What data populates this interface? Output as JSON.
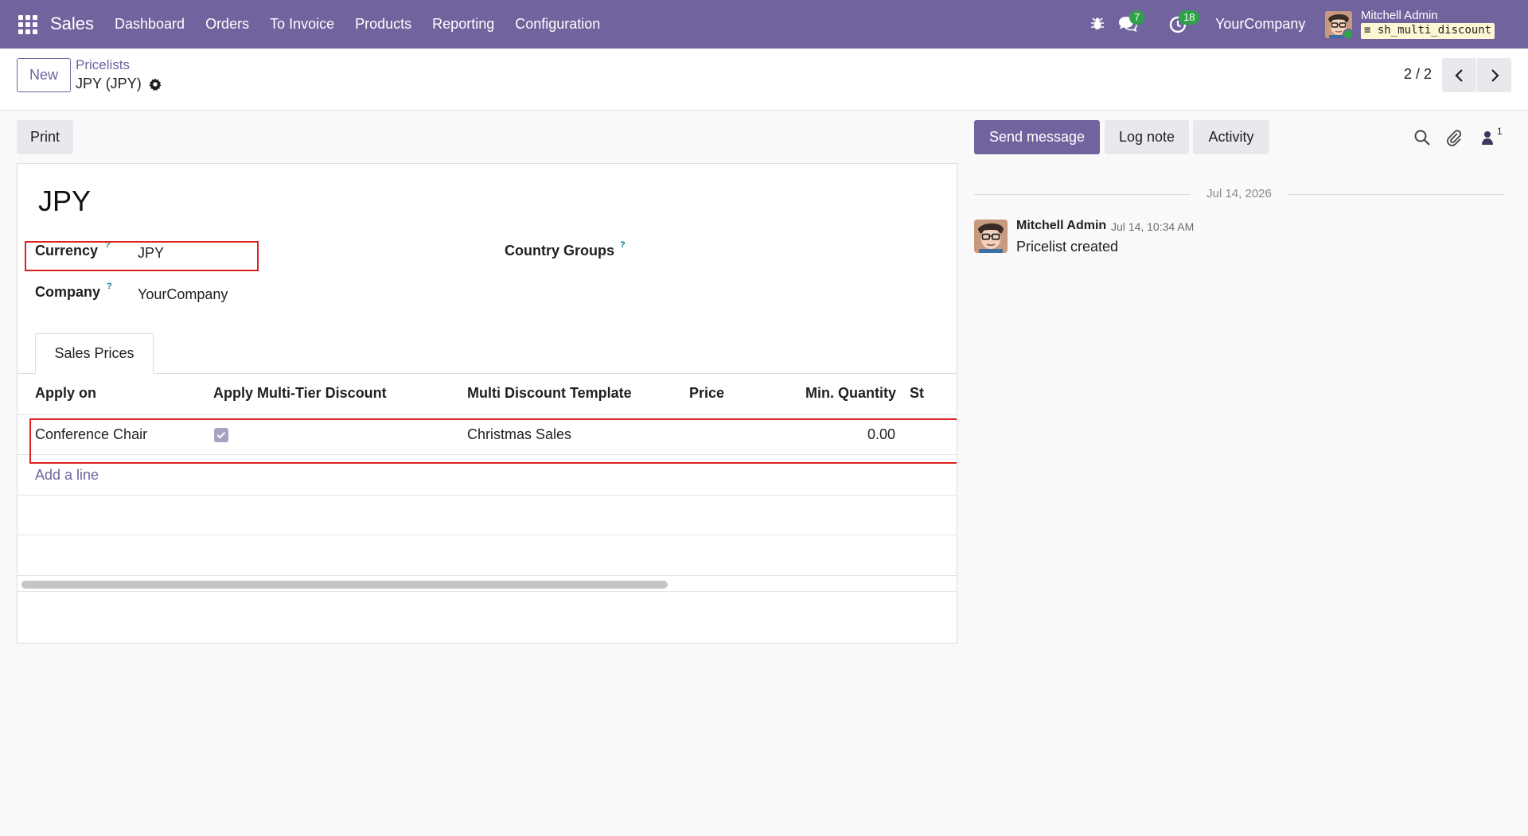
{
  "navbar": {
    "app_name": "Sales",
    "menu": [
      "Dashboard",
      "Orders",
      "To Invoice",
      "Products",
      "Reporting",
      "Configuration"
    ],
    "messages_count": "7",
    "activities_count": "18",
    "company": "YourCompany",
    "user_name": "Mitchell Admin",
    "database": "sh_multi_discount",
    "icons": [
      "apps-grid-icon",
      "bug-icon",
      "chat-icon",
      "clock-icon"
    ]
  },
  "control_panel": {
    "new_label": "New",
    "breadcrumb_parent": "Pricelists",
    "breadcrumb_current": "JPY (JPY)",
    "pager": "2 / 2"
  },
  "form": {
    "print_label": "Print",
    "title": "JPY",
    "currency_label": "Currency",
    "currency_value": "JPY",
    "company_label": "Company",
    "company_value": "YourCompany",
    "country_groups_label": "Country Groups",
    "help_mark": "?",
    "tab_label": "Sales Prices",
    "columns": [
      "Apply on",
      "Apply Multi-Tier Discount",
      "Multi Discount Template",
      "Price",
      "Min. Quantity",
      "St"
    ],
    "rows": [
      {
        "apply_on": "Conference Chair",
        "multi_tier": true,
        "template": "Christmas Sales",
        "price": "",
        "min_quantity": "0.00"
      }
    ],
    "add_line_label": "Add a line"
  },
  "chatter": {
    "send_message_label": "Send message",
    "log_note_label": "Log note",
    "activity_label": "Activity",
    "followers_count": "1",
    "date_separator": "Jul 14, 2026",
    "message": {
      "author": "Mitchell Admin",
      "date": "Jul 14, 10:34 AM",
      "body": "Pricelist created"
    }
  },
  "colors": {
    "brand": "#71639e",
    "highlight": "#e02020",
    "badge": "#2fa14a"
  }
}
